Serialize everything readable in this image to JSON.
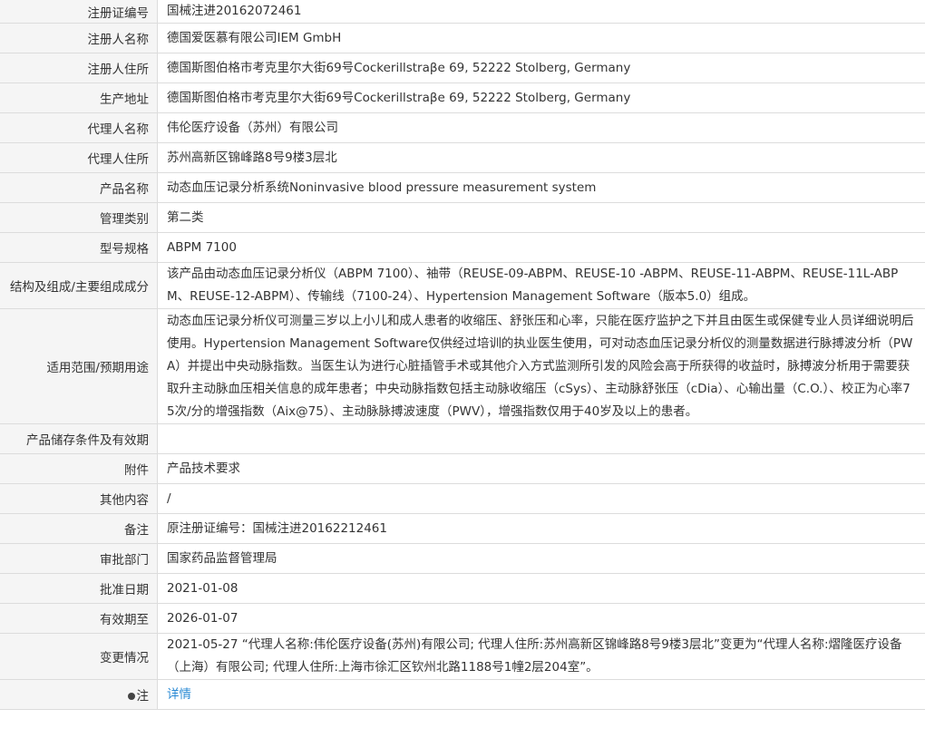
{
  "rows": [
    {
      "label": "注册证编号",
      "value": "国械注进20162072461"
    },
    {
      "label": "注册人名称",
      "value": "德国爱医慕有限公司IEM GmbH"
    },
    {
      "label": "注册人住所",
      "value": "德国斯图伯格市考克里尔大街69号Cockerillstraβe 69, 52222 Stolberg, Germany"
    },
    {
      "label": "生产地址",
      "value": "德国斯图伯格市考克里尔大街69号Cockerillstraβe 69, 52222 Stolberg, Germany"
    },
    {
      "label": "代理人名称",
      "value": "伟伦医疗设备（苏州）有限公司"
    },
    {
      "label": "代理人住所",
      "value": "苏州高新区锦峰路8号9楼3层北"
    },
    {
      "label": "产品名称",
      "value": "动态血压记录分析系统Noninvasive blood pressure measurement system"
    },
    {
      "label": "管理类别",
      "value": "第二类"
    },
    {
      "label": "型号规格",
      "value": "ABPM 7100"
    },
    {
      "label": "结构及组成/主要组成成分",
      "value": "该产品由动态血压记录分析仪（ABPM 7100）、袖带（REUSE-09-ABPM、REUSE-10 -ABPM、REUSE-11-ABPM、REUSE-11L-ABPM、REUSE-12-ABPM）、传输线（7100-24）、Hypertension Management Software（版本5.0）组成。"
    },
    {
      "label": "适用范围/预期用途",
      "value": "动态血压记录分析仪可测量三岁以上小儿和成人患者的收缩压、舒张压和心率，只能在医疗监护之下并且由医生或保健专业人员详细说明后使用。Hypertension Management Software仅供经过培训的执业医生使用，可对动态血压记录分析仪的测量数据进行脉搏波分析（PWA）并提出中央动脉指数。当医生认为进行心脏插管手术或其他介入方式监测所引发的风险会高于所获得的收益时，脉搏波分析用于需要获取升主动脉血压相关信息的成年患者；中央动脉指数包括主动脉收缩压（cSys）、主动脉舒张压（cDia）、心输出量（C.O.）、校正为心率75次/分的增强指数（Aix@75）、主动脉脉搏波速度（PWV），增强指数仅用于40岁及以上的患者。"
    },
    {
      "label": "产品储存条件及有效期",
      "value": ""
    },
    {
      "label": "附件",
      "value": "产品技术要求"
    },
    {
      "label": "其他内容",
      "value": "/"
    },
    {
      "label": "备注",
      "value": "原注册证编号：国械注进20162212461"
    },
    {
      "label": "审批部门",
      "value": "国家药品监督管理局"
    },
    {
      "label": "批准日期",
      "value": "2021-01-08"
    },
    {
      "label": "有效期至",
      "value": "2026-01-07"
    },
    {
      "label": "变更情况",
      "value": "2021-05-27 “代理人名称:伟伦医疗设备(苏州)有限公司; 代理人住所:苏州高新区锦峰路8号9楼3层北”变更为“代理人名称:熠隆医疗设备（上海）有限公司; 代理人住所:上海市徐汇区钦州北路1188号1幢2层204室”。"
    },
    {
      "label": "注",
      "value": "详情"
    }
  ],
  "icons": {
    "note_icon": "lightbulb-icon"
  },
  "colors": {
    "link": "#2a8ad4",
    "label_bg": "#f5f5f5",
    "border": "#dcdcdc"
  }
}
